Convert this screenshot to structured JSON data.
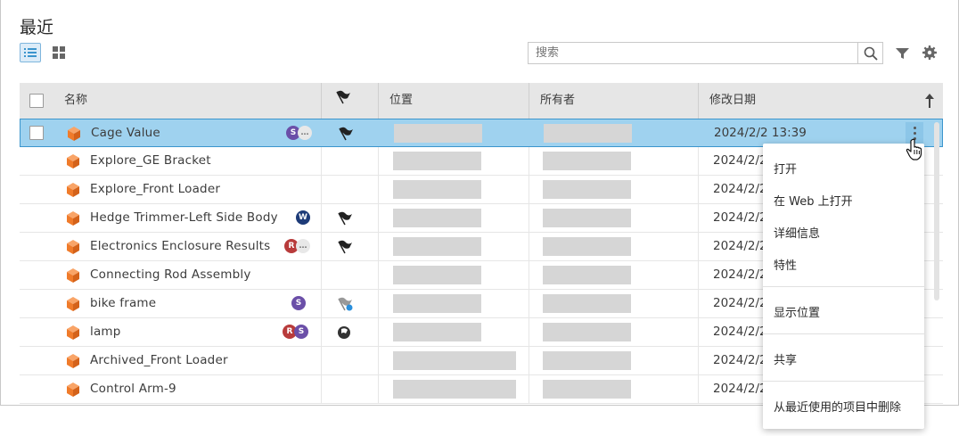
{
  "header": {
    "title": "最近",
    "search_placeholder": "搜索"
  },
  "toolbar": {
    "list_view_icon": "list-view-icon",
    "grid_view_icon": "grid-view-icon",
    "search_icon": "search-icon",
    "filter_icon": "filter-icon",
    "settings_icon": "gear-icon"
  },
  "columns": {
    "name": "名称",
    "flag_icon": "flag-icon",
    "location": "位置",
    "owner": "所有者",
    "modified": "修改日期",
    "sort_icon": "sort-ascending-arrow-icon"
  },
  "rows": [
    {
      "name": "Cage Value",
      "date": "2024/2/2 13:39",
      "avatars": [
        "S",
        "…"
      ]
    },
    {
      "name": "Explore_GE Bracket",
      "date": "2024/2/2"
    },
    {
      "name": "Explore_Front Loader",
      "date": "2024/2/2"
    },
    {
      "name": "Hedge Trimmer-Left Side Body",
      "date": "2024/2/2",
      "avatars": [
        "W"
      ]
    },
    {
      "name": "Electronics Enclosure Results",
      "date": "2024/2/2",
      "avatars": [
        "R",
        "…"
      ]
    },
    {
      "name": "Connecting Rod Assembly",
      "date": "2024/2/2"
    },
    {
      "name": "bike frame",
      "date": "2024/2/2",
      "avatars": [
        "S"
      ]
    },
    {
      "name": "lamp",
      "date": "2024/2/2",
      "avatars": [
        "R",
        "S"
      ]
    },
    {
      "name": "Archived_Front Loader",
      "date": "2024/2/2"
    },
    {
      "name": "Control Arm-9",
      "date": "2024/2/2"
    }
  ],
  "context_menu": {
    "open": "打开",
    "open_web": "在 Web 上打开",
    "details": "详细信息",
    "properties": "特性",
    "show_location": "显示位置",
    "share": "共享",
    "remove_recent": "从最近使用的项目中删除"
  },
  "colors": {
    "selected_row": "#9fd2ef",
    "selected_border": "#3b95cd",
    "cube_orange": "#f07b2a",
    "avatar_purple": "#6b4fa8",
    "avatar_navy": "#1d3b78",
    "avatar_red": "#b83b3b"
  }
}
